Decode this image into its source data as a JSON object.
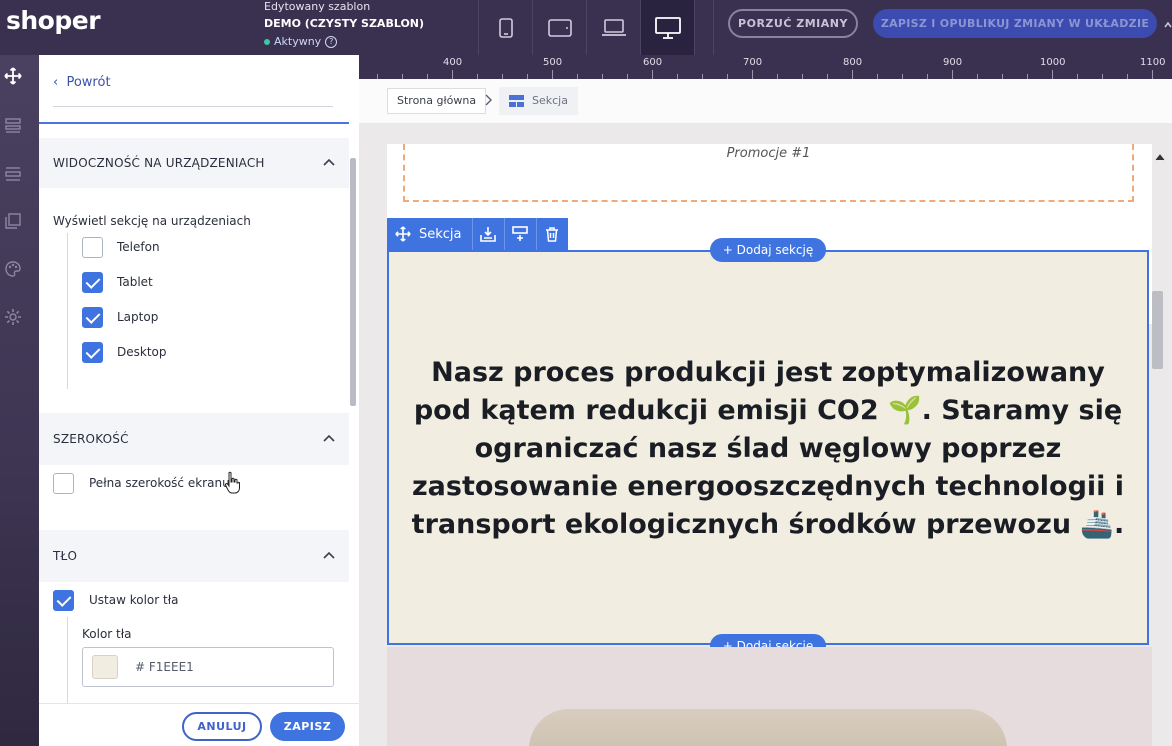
{
  "app": {
    "logo": "shoper"
  },
  "template": {
    "editing_label": "Edytowany szablon",
    "name": "DEMO (CZYSTY SZABLON)",
    "status": "Aktywny",
    "help": "?"
  },
  "actions": {
    "discard": "PORZUĆ ZMIANY",
    "publish": "ZAPISZ I OPUBLIKUJ ZMIANY W UKŁADZIE"
  },
  "devices": [
    {
      "name": "phone-icon"
    },
    {
      "name": "tablet-icon"
    },
    {
      "name": "laptop-icon"
    },
    {
      "name": "desktop-icon",
      "active": true
    }
  ],
  "panel": {
    "back": "Powrót",
    "visibility": {
      "title": "WIDOCZNOŚĆ NA URZĄDZENIACH",
      "subtitle": "Wyświetl sekcję na urządzeniach",
      "options": [
        {
          "label": "Telefon",
          "checked": false
        },
        {
          "label": "Tablet",
          "checked": true
        },
        {
          "label": "Laptop",
          "checked": true
        },
        {
          "label": "Desktop",
          "checked": true
        }
      ]
    },
    "width": {
      "title": "SZEROKOŚĆ",
      "full_width": "Pełna szerokość ekranu",
      "full_width_checked": false
    },
    "background": {
      "title": "TŁO",
      "set_color": "Ustaw kolor tła",
      "set_color_checked": true,
      "color_label": "Kolor tła",
      "color_value": "# F1EEE1",
      "swatch_color": "#F1EEE1"
    },
    "cancel": "ANULUJ",
    "save": "ZAPISZ"
  },
  "ruler": {
    "labels": [
      "400",
      "500",
      "600",
      "700",
      "800",
      "900",
      "1000",
      "1100"
    ]
  },
  "breadcrumb": {
    "home": "Strona główna",
    "current": "Sekcja"
  },
  "canvas": {
    "promo_text": "Promocje #1",
    "section_toolbar_label": "Sekcja",
    "add_section": "+ Dodaj sekcję",
    "headline": "Nasz proces produkcji jest zoptymalizowany pod kątem redukcji emisji CO2 🌱. Staramy się ograniczać nasz ślad węglowy poprzez zastosowanie energooszczędnych technologii i transport ekologicznych środków przewozu 🚢.",
    "section_bg": "#F1EEE1"
  },
  "colors": {
    "accent": "#3f73e0",
    "topbar": "#3a3150"
  }
}
